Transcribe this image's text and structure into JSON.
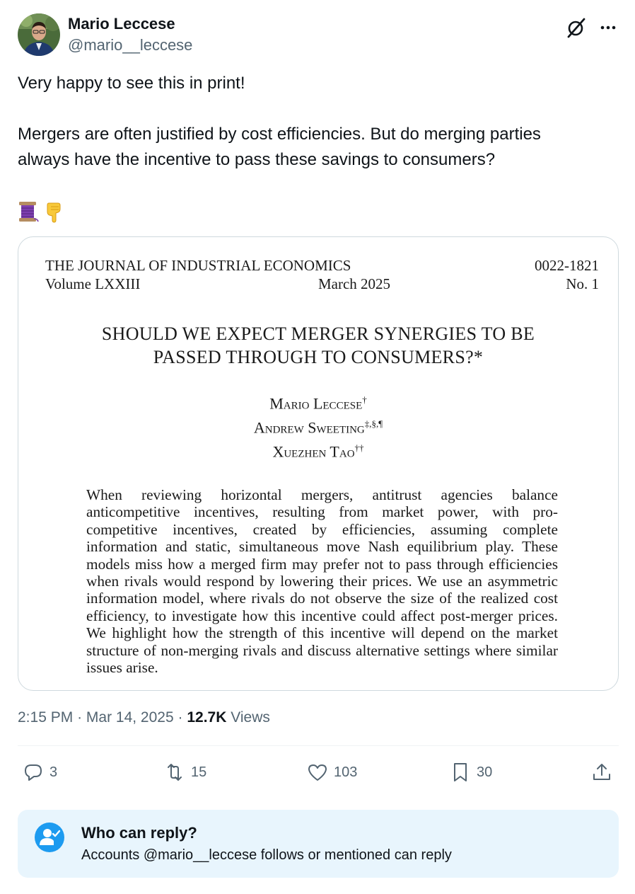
{
  "author": {
    "name": "Mario Leccese",
    "handle": "@mario__leccese"
  },
  "tweet": {
    "line1": "Very happy to see this in print!",
    "line2": "Mergers are often justified by cost efficiencies. But do merging parties",
    "line3": "always have the incentive to pass these savings to consumers?",
    "emojis": [
      "thread-spool-emoji",
      "pointing-down-emoji"
    ]
  },
  "paper": {
    "journal_name": "THE JOURNAL OF INDUSTRIAL ECONOMICS",
    "volume": "Volume LXXIII",
    "date": "March 2025",
    "issn": "0022-1821",
    "issue": "No. 1",
    "title_line1": "SHOULD WE EXPECT MERGER SYNERGIES TO BE",
    "title_line2": "PASSED THROUGH TO CONSUMERS?*",
    "authors": [
      {
        "name": "Mario Leccese",
        "mark": "†"
      },
      {
        "name": "Andrew Sweeting",
        "mark": "‡,§,¶"
      },
      {
        "name": "Xuezhen Tao",
        "mark": "††"
      }
    ],
    "abstract": "When reviewing horizontal mergers, antitrust agencies balance anticompetitive incentives, resulting from market power, with pro-competitive incentives, created by efficiencies, assuming complete information and static, simultaneous move Nash equilibrium play. These models miss how a merged firm may prefer not to pass through efficiencies when rivals would respond by lowering their prices. We use an asymmetric information model, where rivals do not observe the size of the realized cost efficiency, to investigate how this incentive could affect post-merger prices. We highlight how the strength of this incentive will depend on the market structure of non-merging rivals and discuss alternative settings where similar issues arise."
  },
  "meta": {
    "time": "2:15 PM",
    "separator": "·",
    "date": "Mar 14, 2025",
    "views_count": "12.7K",
    "views_label": "Views"
  },
  "actions": {
    "replies": "3",
    "reposts": "15",
    "likes": "103",
    "bookmarks": "30"
  },
  "reply_settings": {
    "title": "Who can reply?",
    "description": "Accounts @mario__leccese follows or mentioned can reply"
  },
  "colors": {
    "accent": "#1d9bf0",
    "secondary_text": "#536471",
    "reply_box_bg": "#e8f5fd"
  }
}
